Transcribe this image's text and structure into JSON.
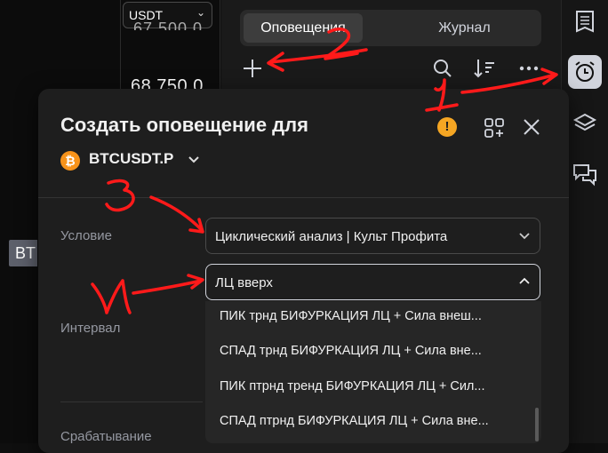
{
  "left_chart": {
    "quote_currency": "USDT",
    "price_partial": "67 500,0",
    "price": "68 750,0",
    "side_tag": "BT"
  },
  "alerts_panel": {
    "tabs": [
      {
        "label": "Оповещения",
        "active": true
      },
      {
        "label": "Журнал",
        "active": false
      }
    ]
  },
  "dialog": {
    "title": "Создать оповещение для",
    "symbol": "BTCUSDT.P",
    "condition_label": "Условие",
    "condition_value": "Циклический анализ | Культ Профита",
    "condition2_value": "ЛЦ вверх",
    "interval_label": "Интервал",
    "trigger_label": "Срабатывание",
    "options": [
      "ПИК трнд БИФУРКАЦИЯ ЛЦ + Сила внеш...",
      "СПАД трнд БИФУРКАЦИЯ ЛЦ + Сила вне...",
      "ПИК птрнд тренд БИФУРКАЦИЯ ЛЦ + Сил...",
      "СПАД птрнд БИФУРКАЦИЯ ЛЦ + Сила вне..."
    ]
  },
  "annotations": {
    "n1": "1",
    "n2": "2",
    "n3": "3",
    "n4": "4"
  },
  "colors": {
    "accent_orange": "#f7931a",
    "warning": "#f5a623",
    "annotation_red": "#ff1a1a"
  }
}
